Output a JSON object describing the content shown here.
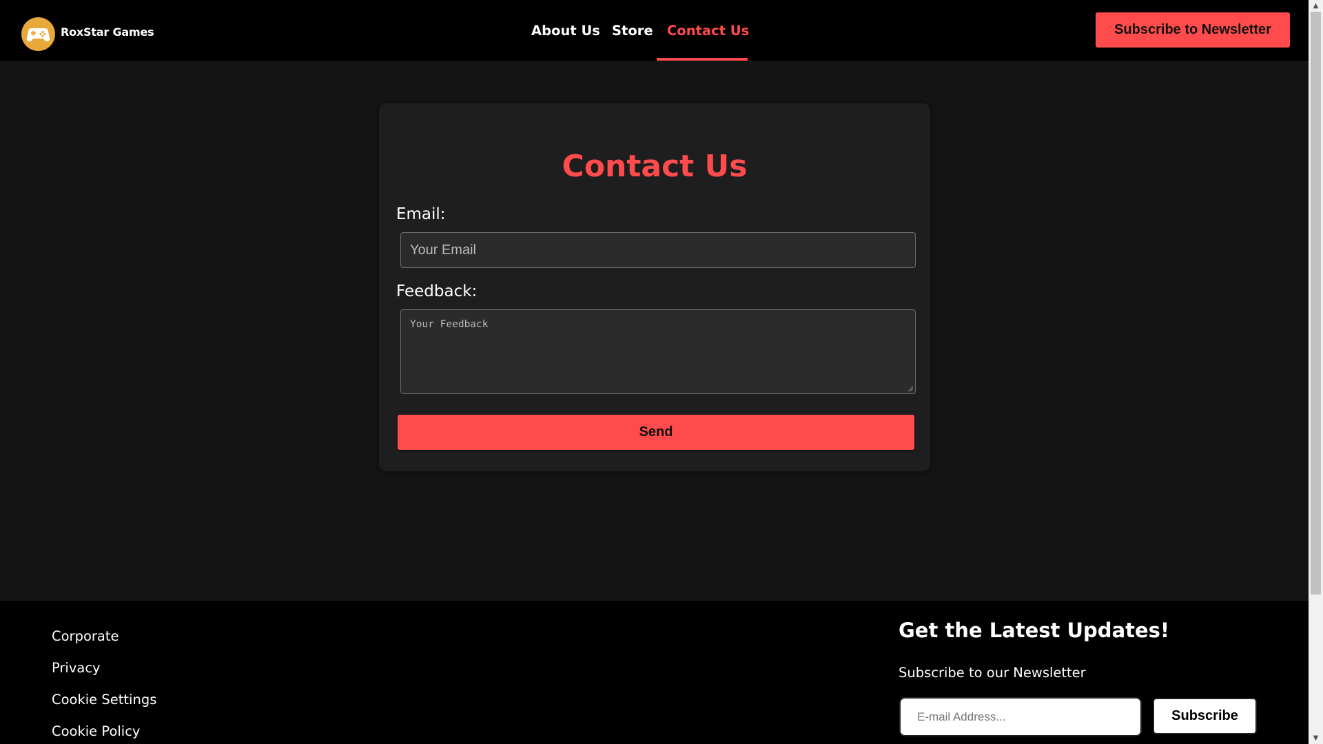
{
  "header": {
    "brand": "RoxStar Games",
    "logo_icon": "gamepad-icon",
    "nav": [
      {
        "label": "About Us",
        "active": false
      },
      {
        "label": "Store",
        "active": false
      },
      {
        "label": "Contact Us",
        "active": true
      }
    ],
    "subscribe_label": "Subscribe to Newsletter"
  },
  "contact": {
    "title": "Contact Us",
    "email_label": "Email:",
    "email_placeholder": "Your Email",
    "feedback_label": "Feedback:",
    "feedback_placeholder": "Your Feedback",
    "send_label": "Send"
  },
  "footer": {
    "links": [
      "Corporate",
      "Privacy",
      "Cookie Settings",
      "Cookie Policy"
    ],
    "heading": "Get the Latest Updates!",
    "subheading": "Subscribe to our Newsletter",
    "email_placeholder": "E-mail Address...",
    "subscribe_label": "Subscribe"
  },
  "colors": {
    "accent": "#ff4b4b",
    "header_bg": "#000000",
    "page_bg": "#141414",
    "card_bg": "#1e1e1e"
  }
}
